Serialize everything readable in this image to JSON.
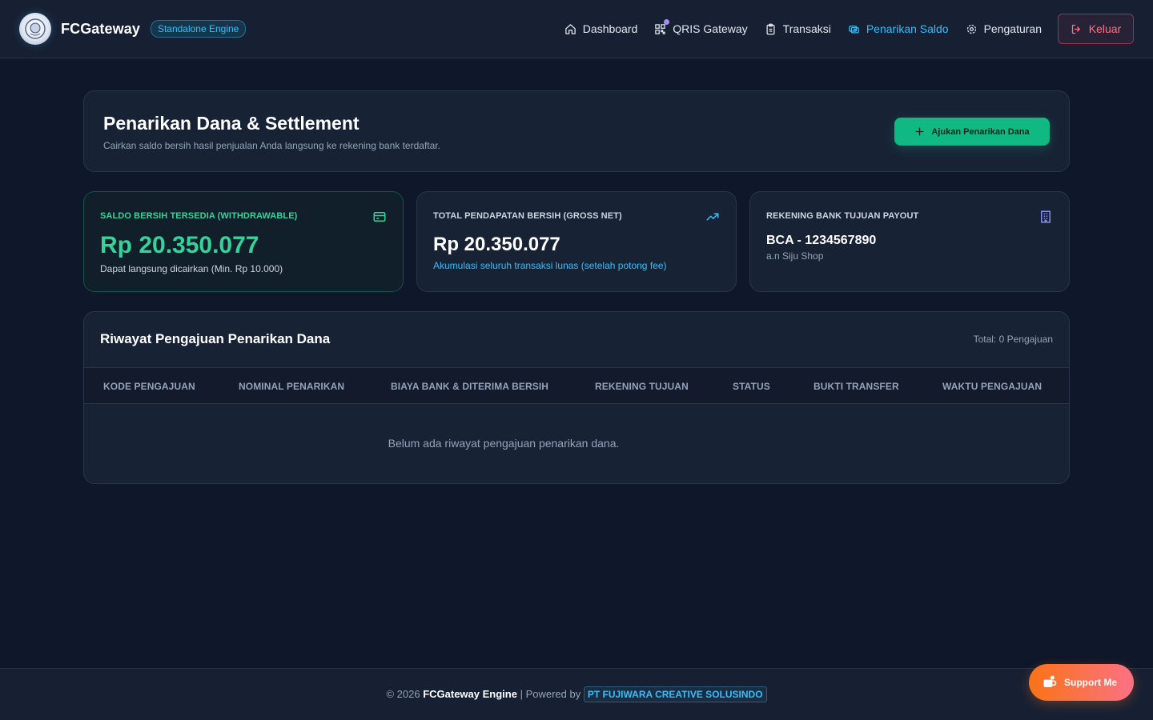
{
  "brand": {
    "name": "FCGateway",
    "badge": "Standalone Engine"
  },
  "nav": {
    "items": [
      {
        "label": "Dashboard",
        "icon": "home-icon"
      },
      {
        "label": "QRIS Gateway",
        "icon": "qr-code-icon"
      },
      {
        "label": "Transaksi",
        "icon": "clipboard-icon"
      },
      {
        "label": "Penarikan Saldo",
        "icon": "wallet-transfer-icon",
        "active": true
      },
      {
        "label": "Pengaturan",
        "icon": "gear-icon"
      }
    ],
    "logout_label": "Keluar"
  },
  "header": {
    "title": "Penarikan Dana & Settlement",
    "subtitle": "Cairkan saldo bersih hasil penjualan Anda langsung ke rekening bank terdaftar.",
    "action_label": "Ajukan Penarikan Dana"
  },
  "stats": {
    "available": {
      "label": "SALDO BERSIH TERSEDIA (WITHDRAWABLE)",
      "value": "Rp 20.350.077",
      "note": "Dapat langsung dicairkan (Min. Rp 10.000)",
      "icon": "card-icon"
    },
    "gross": {
      "label": "TOTAL PENDAPATAN BERSIH (GROSS NET)",
      "value": "Rp 20.350.077",
      "note": "Akumulasi seluruh transaksi lunas (setelah potong fee)",
      "icon": "trending-up-icon"
    },
    "bank": {
      "label": "REKENING BANK TUJUAN PAYOUT",
      "value": "BCA - 1234567890",
      "note": "a.n Siju Shop",
      "icon": "building-icon"
    }
  },
  "history": {
    "title": "Riwayat Pengajuan Penarikan Dana",
    "total": "Total: 0 Pengajuan",
    "columns": [
      "KODE PENGAJUAN",
      "NOMINAL PENARIKAN",
      "BIAYA BANK & DITERIMA BERSIH",
      "REKENING TUJUAN",
      "STATUS",
      "BUKTI TRANSFER",
      "WAKTU PENGAJUAN"
    ],
    "empty_message": "Belum ada riwayat pengajuan penarikan dana."
  },
  "footer": {
    "prefix": "© 2026",
    "engine": "FCGateway Engine",
    "powered": "| Powered by",
    "company": "PT FUJIWARA CREATIVE SOLUSINDO"
  },
  "support_label": "Support Me",
  "colors": {
    "background": "#0f172a",
    "accent_blue": "#38bdf8",
    "accent_green": "#10b981",
    "danger": "#fb7185"
  }
}
